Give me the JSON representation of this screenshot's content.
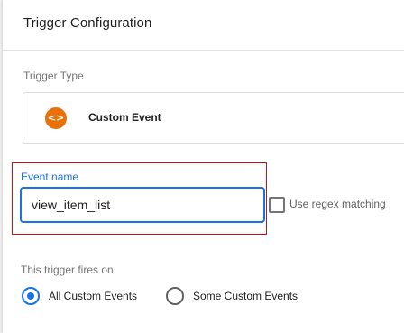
{
  "panel": {
    "title": "Trigger Configuration"
  },
  "trigger_type": {
    "label": "Trigger Type",
    "selected": "Custom Event",
    "icon": "custom-event-icon",
    "icon_glyph": "<>",
    "icon_color": "#e8710a"
  },
  "event_name": {
    "label": "Event name",
    "value": "view_item_list",
    "highlight_color": "#c0151b"
  },
  "regex": {
    "label": "Use regex matching",
    "checked": false
  },
  "fires_on": {
    "label": "This trigger fires on",
    "options": [
      {
        "label": "All Custom Events",
        "selected": true
      },
      {
        "label": "Some Custom Events",
        "selected": false
      }
    ]
  },
  "colors": {
    "accent": "#1a73e8",
    "text": "#212121",
    "muted": "#757575"
  }
}
